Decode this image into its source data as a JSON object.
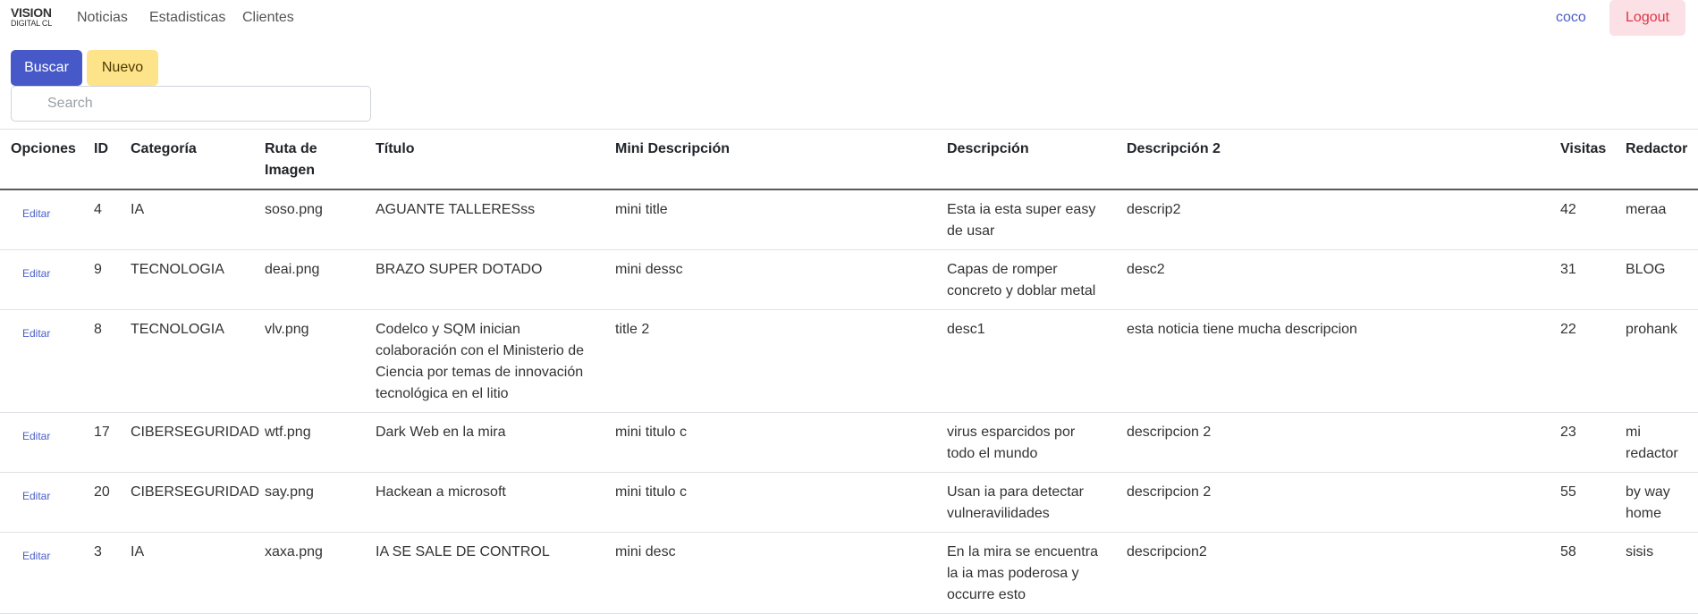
{
  "navbar": {
    "brand_line1": "VISION",
    "brand_line2": "DIGITAL CL",
    "links": [
      "Noticias",
      "Estadisticas",
      "Clientes"
    ],
    "user": "coco",
    "logout_label": "Logout"
  },
  "toolbar": {
    "buscar_label": "Buscar",
    "nuevo_label": "Nuevo",
    "search_placeholder": "Search"
  },
  "table": {
    "headers": [
      "Opciones",
      "ID",
      "Categoría",
      "Ruta de Imagen",
      "Título",
      "Mini Descripción",
      "Descripción",
      "Descripción 2",
      "Visitas",
      "Redactor"
    ],
    "edit_label": "Editar",
    "rows": [
      {
        "id": "4",
        "categoria": "IA",
        "ruta": "soso.png",
        "titulo": "AGUANTE TALLERESss",
        "mini": "mini title",
        "descripcion": "Esta ia esta super easy de usar",
        "descripcion2": "descrip2",
        "visitas": "42",
        "redactor": "meraa"
      },
      {
        "id": "9",
        "categoria": "TECNOLOGIA",
        "ruta": "deai.png",
        "titulo": "BRAZO SUPER DOTADO",
        "mini": "mini dessc",
        "descripcion": "Capas de romper concreto y doblar metal",
        "descripcion2": "desc2",
        "visitas": "31",
        "redactor": "BLOG"
      },
      {
        "id": "8",
        "categoria": "TECNOLOGIA",
        "ruta": "vlv.png",
        "titulo": "Codelco y SQM inician colaboración con el Ministerio de Ciencia por temas de innovación tecnológica en el litio",
        "mini": "title 2",
        "descripcion": "desc1",
        "descripcion2": "esta noticia tiene mucha descripcion",
        "visitas": "22",
        "redactor": "prohank"
      },
      {
        "id": "17",
        "categoria": "CIBERSEGURIDAD",
        "ruta": "wtf.png",
        "titulo": "Dark Web en la mira",
        "mini": "mini titulo c",
        "descripcion": "virus esparcidos por todo el mundo",
        "descripcion2": "descripcion 2",
        "visitas": "23",
        "redactor": "mi redactor"
      },
      {
        "id": "20",
        "categoria": "CIBERSEGURIDAD",
        "ruta": "say.png",
        "titulo": "Hackean a microsoft",
        "mini": "mini titulo c",
        "descripcion": "Usan ia para detectar vulneravilidades",
        "descripcion2": "descripcion 2",
        "visitas": "55",
        "redactor": "by way home"
      },
      {
        "id": "3",
        "categoria": "IA",
        "ruta": "xaxa.png",
        "titulo": "IA SE SALE DE CONTROL",
        "mini": "mini desc",
        "descripcion": "En la mira se encuentra la ia mas poderosa y occurre esto",
        "descripcion2": "descripcion2",
        "visitas": "58",
        "redactor": "sisis"
      }
    ]
  }
}
